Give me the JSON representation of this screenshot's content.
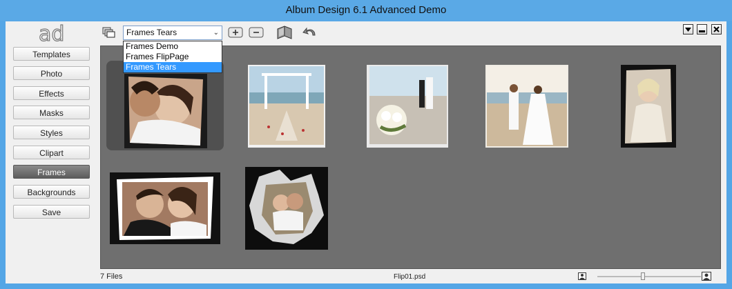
{
  "window": {
    "title": "Album Design 6.1 Advanced Demo"
  },
  "logo": {
    "text": "ad"
  },
  "sidebar": {
    "items": [
      {
        "label": "Templates",
        "active": false
      },
      {
        "label": "Photo",
        "active": false
      },
      {
        "label": "Effects",
        "active": false
      },
      {
        "label": "Masks",
        "active": false
      },
      {
        "label": "Styles",
        "active": false
      },
      {
        "label": "Clipart",
        "active": false
      },
      {
        "label": "Frames",
        "active": true
      },
      {
        "label": "Backgrounds",
        "active": false
      },
      {
        "label": "Save",
        "active": false
      }
    ]
  },
  "toolbar": {
    "category_select": {
      "value": "Frames Tears",
      "arrow": "⌄"
    },
    "dropdown_options": [
      "Frames Demo",
      "Frames FlipPage",
      "Frames Tears"
    ],
    "selected_option": "Frames Tears",
    "icons": [
      "layers-icon",
      "add-icon",
      "remove-icon",
      "book-icon",
      "undo-icon"
    ]
  },
  "gallery": {
    "items": [
      {
        "name": "kiss-portrait",
        "selected": true
      },
      {
        "name": "beach-altar",
        "selected": false
      },
      {
        "name": "bouquet-beach",
        "selected": false
      },
      {
        "name": "couple-walking",
        "selected": false
      },
      {
        "name": "bride-portrait",
        "selected": false
      },
      {
        "name": "couple-closeup",
        "selected": false
      },
      {
        "name": "couple-hug-tear",
        "selected": false
      }
    ]
  },
  "status": {
    "file_count": "7 Files",
    "current_file": "Flip01.psd",
    "zoom_fraction": 0.42
  },
  "colors": {
    "titlebar": "#5aa9e6",
    "gallery_bg": "#6f6f6f",
    "active_tab": "#5c5c5c",
    "highlight": "#3399ff"
  }
}
